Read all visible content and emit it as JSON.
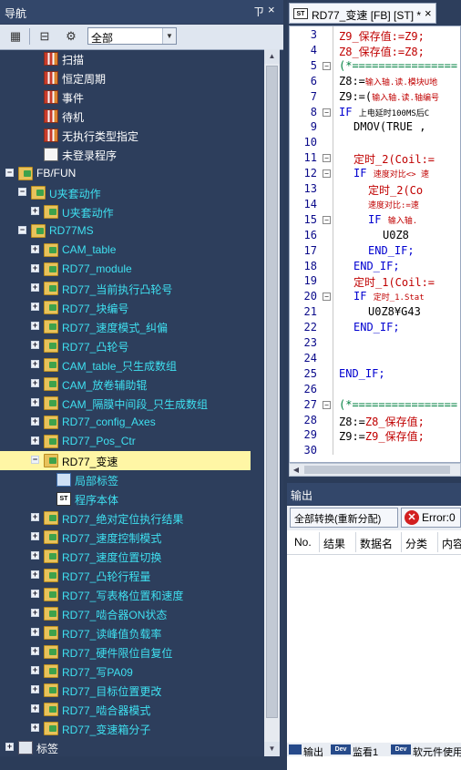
{
  "navigation": {
    "title": "导航",
    "pin_glyph": "ㄗ",
    "close_glyph": "×",
    "toolbar": {
      "filter_value": "全部"
    },
    "tree": [
      {
        "label": "扫描",
        "icon": "program-icon",
        "color": "white",
        "level": 2,
        "expander": ""
      },
      {
        "label": "恒定周期",
        "icon": "program-icon",
        "color": "white",
        "level": 2,
        "expander": ""
      },
      {
        "label": "事件",
        "icon": "program-icon",
        "color": "white",
        "level": 2,
        "expander": ""
      },
      {
        "label": "待机",
        "icon": "program-icon",
        "color": "white",
        "level": 2,
        "expander": ""
      },
      {
        "label": "无执行类型指定",
        "icon": "program-icon",
        "color": "white",
        "level": 2,
        "expander": ""
      },
      {
        "label": "未登录程序",
        "icon": "unregistered-program-icon",
        "color": "white",
        "level": 2,
        "expander": ""
      },
      {
        "label": "FB/FUN",
        "icon": "fb-fun-folder-icon",
        "color": "white",
        "level": 0,
        "expander": "−"
      },
      {
        "label": "U夹套动作",
        "icon": "folder-icon",
        "color": "cyan",
        "level": 1,
        "expander": "−"
      },
      {
        "label": "U夹套动作",
        "icon": "folder-icon",
        "color": "cyan",
        "level": 2,
        "expander": "+"
      },
      {
        "label": "RD77MS",
        "icon": "folder-icon",
        "color": "cyan",
        "level": 1,
        "expander": "−"
      },
      {
        "label": "CAM_table",
        "icon": "folder-icon",
        "color": "cyan",
        "level": 2,
        "expander": "+"
      },
      {
        "label": "RD77_module",
        "icon": "folder-icon",
        "color": "cyan",
        "level": 2,
        "expander": "+"
      },
      {
        "label": "RD77_当前执行凸轮号",
        "icon": "folder-icon",
        "color": "cyan",
        "level": 2,
        "expander": "+"
      },
      {
        "label": "RD77_块编号",
        "icon": "folder-icon",
        "color": "cyan",
        "level": 2,
        "expander": "+"
      },
      {
        "label": "RD77_速度模式_纠偏",
        "icon": "folder-icon",
        "color": "cyan",
        "level": 2,
        "expander": "+"
      },
      {
        "label": "RD77_凸轮号",
        "icon": "folder-icon",
        "color": "cyan",
        "level": 2,
        "expander": "+"
      },
      {
        "label": "CAM_table_只生成数组",
        "icon": "folder-icon",
        "color": "cyan",
        "level": 2,
        "expander": "+"
      },
      {
        "label": "CAM_放卷辅助辊",
        "icon": "folder-icon",
        "color": "cyan",
        "level": 2,
        "expander": "+"
      },
      {
        "label": "CAM_隔膜中间段_只生成数组",
        "icon": "folder-icon",
        "color": "cyan",
        "level": 2,
        "expander": "+"
      },
      {
        "label": "RD77_config_Axes",
        "icon": "folder-icon",
        "color": "cyan",
        "level": 2,
        "expander": "+"
      },
      {
        "label": "RD77_Pos_Ctr",
        "icon": "folder-icon",
        "color": "cyan",
        "level": 2,
        "expander": "+"
      },
      {
        "label": "RD77_变速",
        "icon": "folder-icon",
        "color": "black",
        "level": 2,
        "expander": "−",
        "selected": true
      },
      {
        "label": "局部标签",
        "icon": "local-label-icon",
        "color": "cyan",
        "level": 3,
        "expander": ""
      },
      {
        "label": "程序本体",
        "icon": "st-program-icon",
        "color": "cyan",
        "level": 3,
        "expander": ""
      },
      {
        "label": "RD77_绝对定位执行结果",
        "icon": "folder-icon",
        "color": "cyan",
        "level": 2,
        "expander": "+"
      },
      {
        "label": "RD77_速度控制模式",
        "icon": "folder-icon",
        "color": "cyan",
        "level": 2,
        "expander": "+"
      },
      {
        "label": "RD77_速度位置切换",
        "icon": "folder-icon",
        "color": "cyan",
        "level": 2,
        "expander": "+"
      },
      {
        "label": "RD77_凸轮行程量",
        "icon": "folder-icon",
        "color": "cyan",
        "level": 2,
        "expander": "+"
      },
      {
        "label": "RD77_写表格位置和速度",
        "icon": "folder-icon",
        "color": "cyan",
        "level": 2,
        "expander": "+"
      },
      {
        "label": "RD77_啮合器ON状态",
        "icon": "folder-icon",
        "color": "cyan",
        "level": 2,
        "expander": "+"
      },
      {
        "label": "RD77_读峰值负载率",
        "icon": "folder-icon",
        "color": "cyan",
        "level": 2,
        "expander": "+"
      },
      {
        "label": "RD77_硬件限位自复位",
        "icon": "folder-icon",
        "color": "cyan",
        "level": 2,
        "expander": "+"
      },
      {
        "label": "RD77_写PA09",
        "icon": "folder-icon",
        "color": "cyan",
        "level": 2,
        "expander": "+"
      },
      {
        "label": "RD77_目标位置更改",
        "icon": "folder-icon",
        "color": "cyan",
        "level": 2,
        "expander": "+"
      },
      {
        "label": "RD77_啮合器模式",
        "icon": "folder-icon",
        "color": "cyan",
        "level": 2,
        "expander": "+"
      },
      {
        "label": "RD77_变速箱分子",
        "icon": "folder-icon",
        "color": "cyan",
        "level": 2,
        "expander": "+"
      },
      {
        "label": "标签",
        "icon": "tag-icon",
        "color": "white",
        "level": 0,
        "expander": "+"
      }
    ]
  },
  "editor": {
    "tab_label": "RD77_变速 [FB] [ST] *",
    "tab_icon_text": "ST",
    "close_glyph": "×",
    "lines": [
      {
        "n": "3",
        "fold": "",
        "indent": 0,
        "parts": [
          {
            "t": "Z9_保存值:=Z9;",
            "c": "red"
          }
        ]
      },
      {
        "n": "4",
        "fold": "",
        "indent": 0,
        "parts": [
          {
            "t": "Z8_保存值:=Z8;",
            "c": "red"
          }
        ]
      },
      {
        "n": "5",
        "fold": "−",
        "indent": 0,
        "parts": [
          {
            "t": "(*================",
            "c": "green"
          }
        ]
      },
      {
        "n": "6",
        "fold": "",
        "indent": 0,
        "parts": [
          {
            "t": "Z8:=",
            "c": "black"
          },
          {
            "t": "输入轴.读.模块U地",
            "c": "red",
            "small": true
          }
        ]
      },
      {
        "n": "7",
        "fold": "",
        "indent": 0,
        "parts": [
          {
            "t": "Z9:=(",
            "c": "black"
          },
          {
            "t": "输入轴.读.轴编号",
            "c": "red",
            "small": true
          }
        ]
      },
      {
        "n": "8",
        "fold": "−",
        "indent": 0,
        "parts": [
          {
            "t": "IF ",
            "c": "blue"
          },
          {
            "t": "上电延时100MS后C",
            "c": "black",
            "small": true
          }
        ]
      },
      {
        "n": "9",
        "fold": "",
        "indent": 2,
        "parts": [
          {
            "t": "DMOV(TRUE ,",
            "c": "black"
          }
        ]
      },
      {
        "n": "10",
        "fold": "",
        "indent": 0,
        "parts": []
      },
      {
        "n": "11",
        "fold": "−",
        "indent": 2,
        "parts": [
          {
            "t": "定时_2(Coil:=",
            "c": "red"
          }
        ]
      },
      {
        "n": "12",
        "fold": "−",
        "indent": 2,
        "parts": [
          {
            "t": "IF ",
            "c": "blue"
          },
          {
            "t": "速度对比<> 速",
            "c": "red",
            "small": true
          }
        ]
      },
      {
        "n": "13",
        "fold": "",
        "indent": 4,
        "parts": [
          {
            "t": "定时_2(Co",
            "c": "red"
          }
        ]
      },
      {
        "n": "14",
        "fold": "",
        "indent": 4,
        "parts": [
          {
            "t": "速度对比:=速",
            "c": "red",
            "small": true
          }
        ]
      },
      {
        "n": "15",
        "fold": "−",
        "indent": 4,
        "parts": [
          {
            "t": "IF ",
            "c": "blue"
          },
          {
            "t": "输入轴.",
            "c": "red",
            "small": true
          }
        ]
      },
      {
        "n": "16",
        "fold": "",
        "indent": 6,
        "parts": [
          {
            "t": "U0Z8",
            "c": "black"
          }
        ]
      },
      {
        "n": "17",
        "fold": "",
        "indent": 4,
        "parts": [
          {
            "t": "END_IF;",
            "c": "blue"
          }
        ]
      },
      {
        "n": "18",
        "fold": "",
        "indent": 2,
        "parts": [
          {
            "t": "END_IF;",
            "c": "blue"
          }
        ]
      },
      {
        "n": "19",
        "fold": "",
        "indent": 2,
        "parts": [
          {
            "t": "定时_1(Coil:=",
            "c": "red"
          }
        ]
      },
      {
        "n": "20",
        "fold": "−",
        "indent": 2,
        "parts": [
          {
            "t": "IF ",
            "c": "blue"
          },
          {
            "t": "定时_1.Stat",
            "c": "red",
            "small": true
          }
        ]
      },
      {
        "n": "21",
        "fold": "",
        "indent": 4,
        "parts": [
          {
            "t": "U0Z8¥G43",
            "c": "black"
          }
        ]
      },
      {
        "n": "22",
        "fold": "",
        "indent": 2,
        "parts": [
          {
            "t": "END_IF;",
            "c": "blue"
          }
        ]
      },
      {
        "n": "23",
        "fold": "",
        "indent": 0,
        "parts": []
      },
      {
        "n": "24",
        "fold": "",
        "indent": 0,
        "parts": []
      },
      {
        "n": "25",
        "fold": "",
        "indent": 0,
        "parts": [
          {
            "t": "END_IF;",
            "c": "blue"
          }
        ]
      },
      {
        "n": "26",
        "fold": "",
        "indent": 0,
        "parts": []
      },
      {
        "n": "27",
        "fold": "−",
        "indent": 0,
        "parts": [
          {
            "t": "(*================",
            "c": "green"
          }
        ]
      },
      {
        "n": "28",
        "fold": "",
        "indent": 0,
        "parts": [
          {
            "t": "Z8:=",
            "c": "black"
          },
          {
            "t": "Z8_保存值;",
            "c": "red"
          }
        ]
      },
      {
        "n": "29",
        "fold": "",
        "indent": 0,
        "parts": [
          {
            "t": "Z9:=",
            "c": "black"
          },
          {
            "t": "Z9_保存值;",
            "c": "red"
          }
        ]
      },
      {
        "n": "30",
        "fold": "",
        "indent": 0,
        "parts": []
      }
    ]
  },
  "output": {
    "title": "输出",
    "all_button": "全部转换(重新分配)",
    "error_button": "Error:0",
    "error_glyph": "✕",
    "columns": [
      "No.",
      "结果",
      "数据名",
      "分类",
      "内容"
    ]
  },
  "bottom_tabs": [
    {
      "icon": "",
      "label": "输出"
    },
    {
      "icon": "Dev",
      "label": "监看1"
    },
    {
      "icon": "Dev",
      "label": "软元件使用"
    }
  ],
  "colors": {
    "panel_bg": "#2d3e5c",
    "tree_cyan": "#3fe0f0",
    "selected_bg": "#fff6a5",
    "keyword_blue": "#0000d0",
    "string_red": "#c00000"
  }
}
